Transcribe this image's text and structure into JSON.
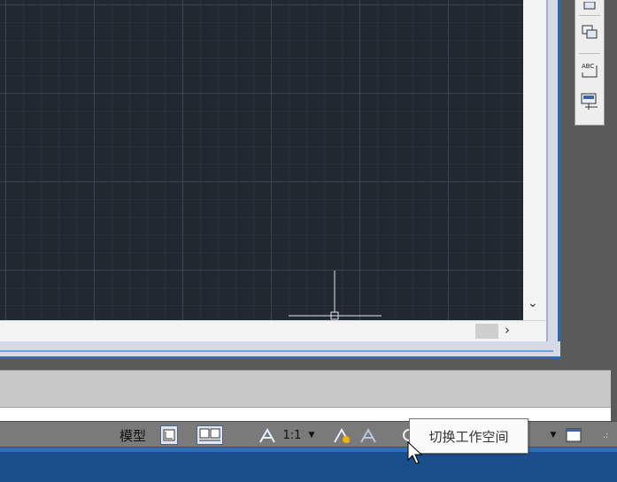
{
  "statusbar": {
    "model_label": "模型",
    "annotation_scale": "1:1"
  },
  "tooltip": {
    "text": "切换工作空间"
  },
  "scrollbars": {
    "vertical_arrow": "⌄",
    "horizontal_arrow": "›"
  },
  "toolbar": {
    "text_icon_label": "ABC"
  },
  "colors": {
    "canvas_bg": "#212830",
    "grid_major": "#465262",
    "frame_blue": "#2c67b7",
    "taskbar": "#1b4f8c"
  },
  "icons": [
    "copy-window-icon",
    "abc-text-field-icon",
    "table-icon",
    "paper-space-icon",
    "layout-icon",
    "annotation-scale-icon",
    "annotation-visibility-icon",
    "auto-scale-icon",
    "workspace-switch-icon",
    "lock-icon",
    "hardware-acceleration-icon",
    "isolate-objects-icon",
    "clean-screen-icon",
    "crosshair-cursor-icon",
    "mouse-pointer-icon"
  ]
}
